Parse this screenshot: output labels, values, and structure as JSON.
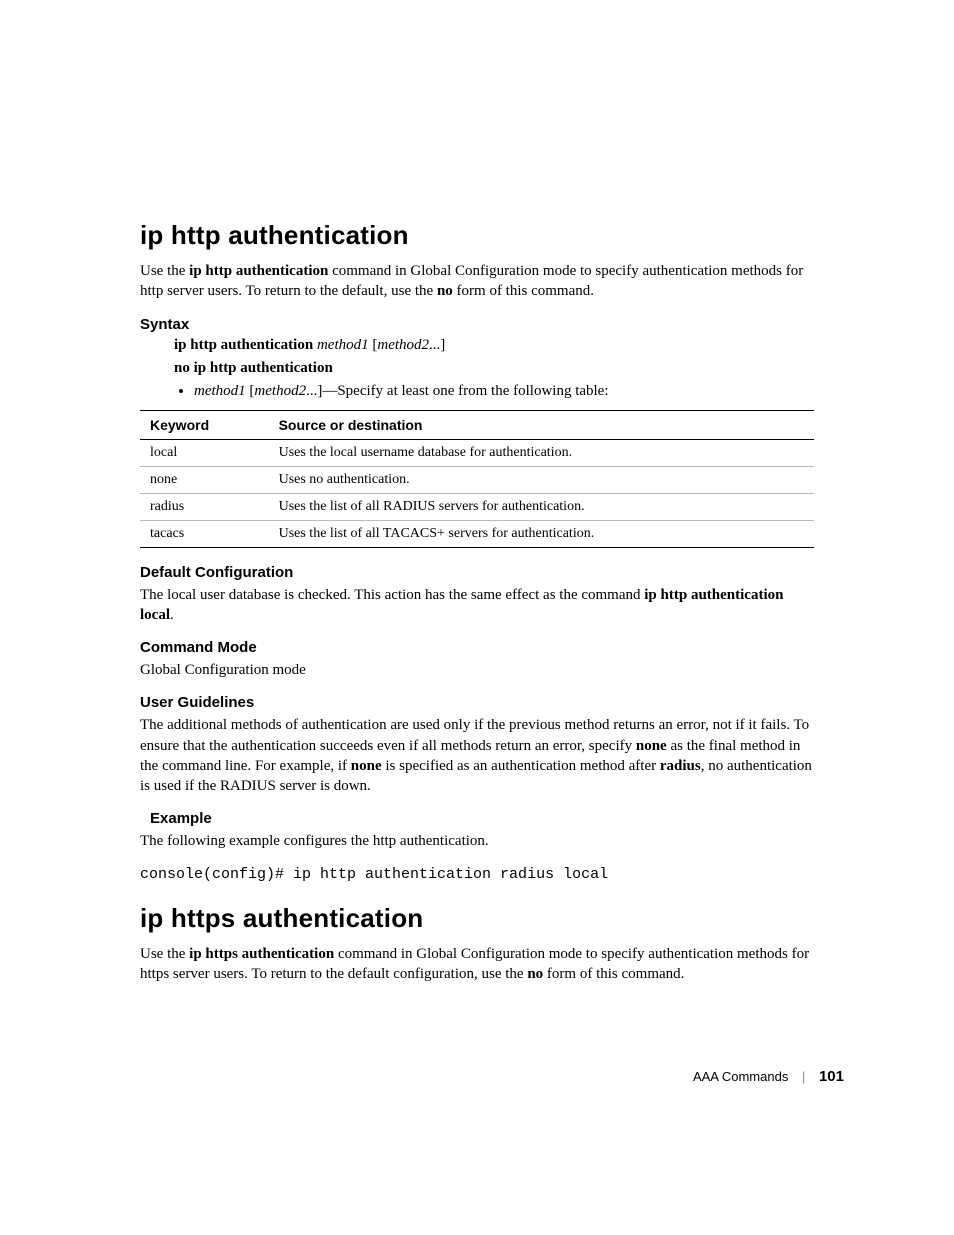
{
  "section1": {
    "title": "ip http authentication",
    "intro_parts": [
      "Use the ",
      "ip http authentication",
      " command in Global Configuration mode to specify authentication methods for http server users. To return to the default, use the ",
      "no",
      " form of this command."
    ],
    "syntax": {
      "heading": "Syntax",
      "line1_bold": "ip http authentication",
      "line1_ital1": "method1",
      "line1_lb": " [",
      "line1_ital2": "method2",
      "line1_rest": "...]",
      "line2": "no ip http authentication",
      "bullet_ital1": "method1",
      "bullet_lb": " [",
      "bullet_ital2": "method2",
      "bullet_rest": "...]—Specify at least one from the following table:"
    },
    "table": {
      "h1": "Keyword",
      "h2": "Source or destination",
      "rows": [
        {
          "k": "local",
          "d": "Uses the local username database for authentication."
        },
        {
          "k": "none",
          "d": "Uses no authentication."
        },
        {
          "k": "radius",
          "d": "Uses the list of all RADIUS servers for authentication."
        },
        {
          "k": "tacacs",
          "d": "Uses the list of all TACACS+ servers for authentication."
        }
      ]
    },
    "defcfg": {
      "heading": "Default Configuration",
      "p1": "The local user database is checked. This action has the same effect as the command ",
      "bold": "ip http authentication local",
      "p2": "."
    },
    "mode": {
      "heading": "Command Mode",
      "text": "Global Configuration mode"
    },
    "guide": {
      "heading": "User Guidelines",
      "p1": "The additional methods of authentication are used only if the previous method returns an error, not if it fails. To ensure that the authentication succeeds even if all methods return an error, specify ",
      "b1": "none",
      "p2": " as the final method in the command line. For example, if ",
      "b2": "none",
      "p3": " is specified as an authentication method after ",
      "b3": "radius",
      "p4": ", no authentication is used if the RADIUS server is down."
    },
    "example": {
      "heading": "Example",
      "text": "The following example configures the http authentication.",
      "code": "console(config)# ip http authentication radius local"
    }
  },
  "section2": {
    "title": "ip https authentication",
    "intro_parts": [
      "Use the ",
      "ip https authentication",
      " command in Global Configuration mode to specify authentication methods for https server users. To return to the default configuration, use the ",
      "no",
      " form of this command."
    ]
  },
  "footer": {
    "chapter": "AAA Commands",
    "page": "101"
  }
}
